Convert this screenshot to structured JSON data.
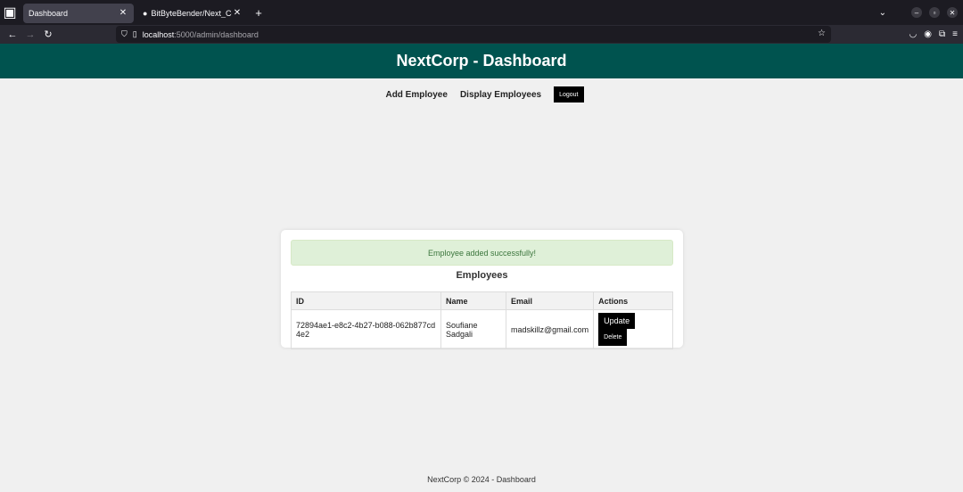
{
  "browser": {
    "tabs": [
      {
        "title": "Dashboard",
        "active": true
      },
      {
        "title": "BitByteBender/Next_Corp",
        "active": false
      }
    ],
    "url_host": "localhost",
    "url_path": ":5000/admin/dashboard"
  },
  "header": {
    "title": "NextCorp - Dashboard"
  },
  "menu": {
    "add_employee": "Add Employee",
    "display_employees": "Display Employees",
    "logout": "Logout"
  },
  "alert": {
    "message": "Employee added successfully!"
  },
  "employees": {
    "title": "Employees",
    "columns": [
      "ID",
      "Name",
      "Email",
      "Actions"
    ],
    "rows": [
      {
        "id": "72894ae1-e8c2-4b27-b088-062b877cd4e2",
        "name": "Soufiane Sadgali",
        "email": "madskillz@gmail.com",
        "update_label": "Update",
        "delete_label": "Delete"
      }
    ]
  },
  "footer": {
    "text": "NextCorp © 2024 - Dashboard"
  },
  "colors": {
    "header_bg": "#00534f",
    "alert_bg": "#dff0d8",
    "alert_text": "#3c763d"
  }
}
